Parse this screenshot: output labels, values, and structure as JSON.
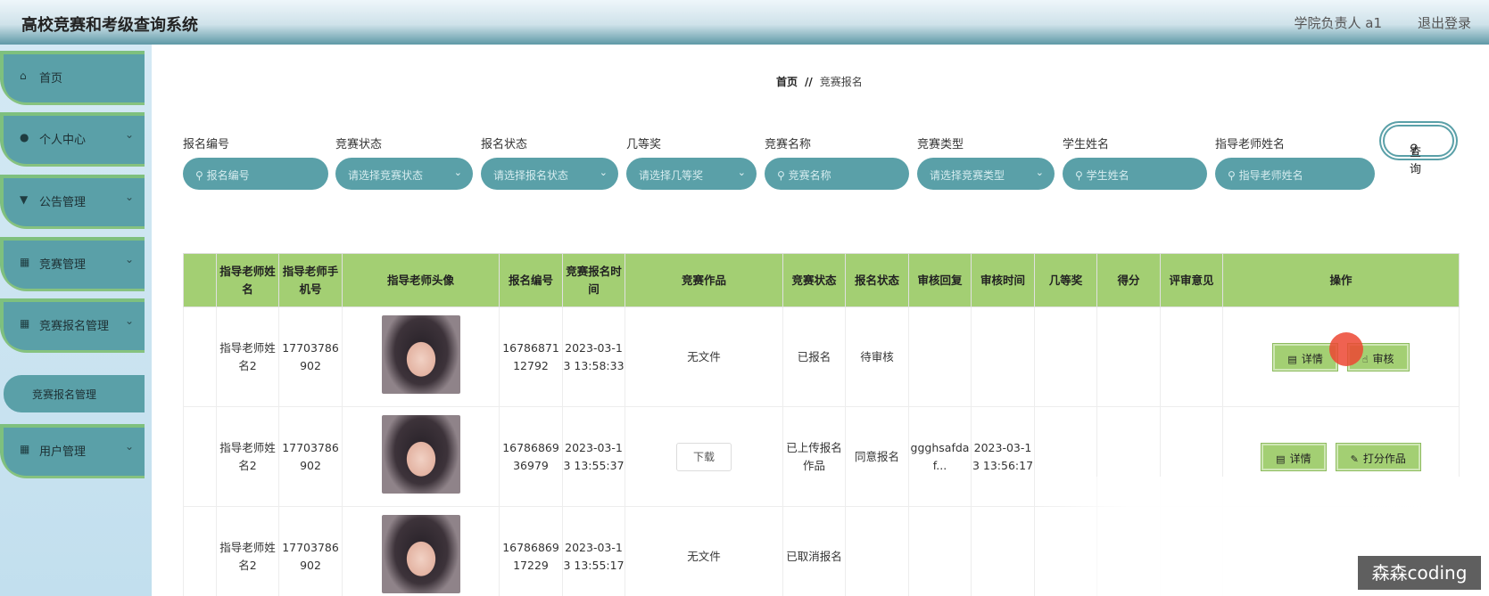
{
  "header": {
    "title": "高校竞赛和考级查询系统",
    "user": "学院负责人 a1",
    "logout": "退出登录"
  },
  "sidebar": {
    "items": [
      {
        "label": "首页",
        "icon": "home-icon"
      },
      {
        "label": "个人中心",
        "icon": "user-icon"
      },
      {
        "label": "公告管理",
        "icon": "pin-icon"
      },
      {
        "label": "竞赛管理",
        "icon": "grid-icon"
      },
      {
        "label": "竞赛报名管理",
        "icon": "grid-icon"
      },
      {
        "label": "用户管理",
        "icon": "grid-icon"
      }
    ],
    "sub_item": "竞赛报名管理"
  },
  "breadcrumb": {
    "home": "首页",
    "separator": "//",
    "current": "竞赛报名"
  },
  "filters": [
    {
      "label": "报名编号",
      "placeholder": "报名编号",
      "type": "search"
    },
    {
      "label": "竞赛状态",
      "placeholder": "请选择竞赛状态",
      "type": "select"
    },
    {
      "label": "报名状态",
      "placeholder": "请选择报名状态",
      "type": "select"
    },
    {
      "label": "几等奖",
      "placeholder": "请选择几等奖",
      "type": "select"
    },
    {
      "label": "竞赛名称",
      "placeholder": "竞赛名称",
      "type": "search"
    },
    {
      "label": "竞赛类型",
      "placeholder": "请选择竞赛类型",
      "type": "select"
    },
    {
      "label": "学生姓名",
      "placeholder": "学生姓名",
      "type": "search"
    },
    {
      "label": "指导老师姓名",
      "placeholder": "指导老师姓名",
      "type": "search"
    }
  ],
  "search_button": "查询",
  "table": {
    "headers": [
      "",
      "指导老师姓名",
      "指导老师手机号",
      "指导老师头像",
      "报名编号",
      "竞赛报名时间",
      "竞赛作品",
      "竞赛状态",
      "报名状态",
      "审核回复",
      "审核时间",
      "几等奖",
      "得分",
      "评审意见",
      "操作"
    ],
    "rows": [
      {
        "teacher_name": "指导老师姓名2",
        "phone": "17703786902",
        "reg_no": "1678687112792",
        "reg_time": "2023-03-13 13:58:33",
        "work": "无文件",
        "comp_status": "已报名",
        "reg_status": "待审核",
        "reply": "",
        "review_time": "",
        "prize": "",
        "score": "",
        "opinion": "",
        "actions": [
          "详情",
          "审核"
        ]
      },
      {
        "teacher_name": "指导老师姓名2",
        "phone": "17703786902",
        "reg_no": "1678686936979",
        "reg_time": "2023-03-13 13:55:37",
        "work": "下载",
        "comp_status": "已上传报名作品",
        "reg_status": "同意报名",
        "reply": "ggghsafdaf...",
        "review_time": "2023-03-13 13:56:17",
        "prize": "",
        "score": "",
        "opinion": "",
        "actions": [
          "详情",
          "打分作品"
        ]
      },
      {
        "teacher_name": "指导老师姓名2",
        "phone": "17703786902",
        "reg_no": "1678686917229",
        "reg_time": "2023-03-13 13:55:17",
        "work": "无文件",
        "comp_status": "已取消报名",
        "reg_status": "",
        "reply": "",
        "review_time": "",
        "prize": "",
        "score": "",
        "opinion": "",
        "actions": []
      }
    ]
  },
  "watermark": "森森coding",
  "colors": {
    "teal": "#5aa0a8",
    "green": "#a3cf73",
    "cursor": "#ec4632"
  }
}
